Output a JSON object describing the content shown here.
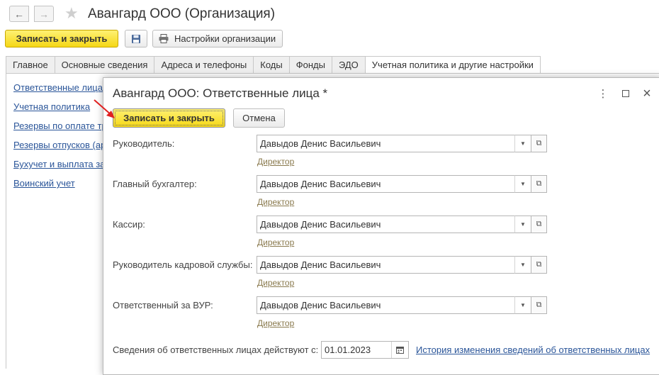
{
  "window": {
    "title": "Авангард ООО (Организация)",
    "back_icon": "arrow-left-icon",
    "forward_icon": "arrow-right-icon",
    "favorite_icon": "star-icon"
  },
  "toolbar": {
    "save_close_label": "Записать и закрыть",
    "save_icon": "floppy-disk-icon",
    "org_settings_label": "Настройки организации",
    "org_settings_icon": "printer-icon"
  },
  "tabs": [
    {
      "label": "Главное",
      "active": false
    },
    {
      "label": "Основные сведения",
      "active": false
    },
    {
      "label": "Адреса и телефоны",
      "active": false
    },
    {
      "label": "Коды",
      "active": false
    },
    {
      "label": "Фонды",
      "active": false
    },
    {
      "label": "ЭДО",
      "active": false
    },
    {
      "label": "Учетная политика и другие настройки",
      "active": true
    }
  ],
  "left_links": [
    {
      "label": "Ответственные лица"
    },
    {
      "label": "Учетная политика"
    },
    {
      "label": "Резервы по оплате тр"
    },
    {
      "label": "Резервы отпусков (ар"
    },
    {
      "label": "Бухучет и выплата за"
    },
    {
      "label": "Воинский учет"
    }
  ],
  "modal": {
    "title": "Авангард ООО: Ответственные лица *",
    "more_icon": "more-vertical-icon",
    "maximize_icon": "maximize-icon",
    "close_icon": "close-icon",
    "save_close_label": "Записать и закрыть",
    "cancel_label": "Отмена",
    "fields": [
      {
        "label": "Руководитель:",
        "value": "Давыдов Денис Васильевич",
        "position": "Директор"
      },
      {
        "label": "Главный бухгалтер:",
        "value": "Давыдов Денис Васильевич",
        "position": "Директор"
      },
      {
        "label": "Кассир:",
        "value": "Давыдов Денис Васильевич",
        "position": "Директор"
      },
      {
        "label": "Руководитель кадровой службы:",
        "value": "Давыдов Денис Васильевич",
        "position": "Директор"
      },
      {
        "label": "Ответственный за ВУР:",
        "value": "Давыдов Денис Васильевич",
        "position": "Директор"
      }
    ],
    "date_label": "Сведения об ответственных лицах действуют с:",
    "date_value": "01.01.2023",
    "calendar_icon": "calendar-icon",
    "history_link": "История изменения сведений об ответственных лицах"
  },
  "colors": {
    "primary_button": "#f5d716",
    "link": "#2a5599",
    "position_link": "#8a7a4e",
    "annotation_arrow": "#e02020"
  }
}
